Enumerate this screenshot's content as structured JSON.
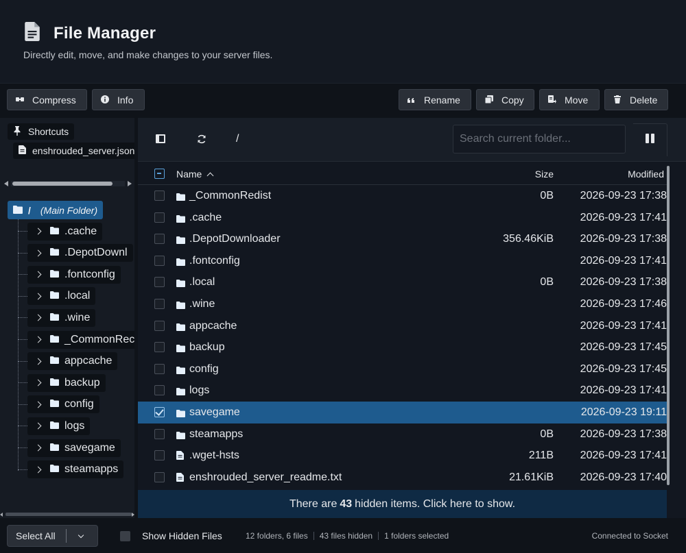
{
  "header": {
    "icon": "file-icon",
    "title": "File Manager",
    "subtitle": "Directly edit, move, and make changes to your server files."
  },
  "toolbar": {
    "compress": "Compress",
    "info": "Info",
    "rename": "Rename",
    "copy": "Copy",
    "move": "Move",
    "delete": "Delete"
  },
  "sidebar": {
    "shortcuts_label": "Shortcuts",
    "shortcut_file": "enshrouded_server.json",
    "root_slash": "/",
    "root_label": "(Main Folder)",
    "tree": [
      ".cache",
      ".DepotDownl",
      ".fontconfig",
      ".local",
      ".wine",
      "_CommonRec",
      "appcache",
      "backup",
      "config",
      "logs",
      "savegame",
      "steamapps"
    ]
  },
  "main": {
    "path": "/",
    "search_placeholder": "Search current folder...",
    "columns": {
      "name": "Name",
      "size": "Size",
      "modified": "Modified"
    },
    "rows": [
      {
        "type": "folder",
        "name": "_CommonRedist",
        "size": "0B",
        "modified": "2026-09-23 17:38",
        "selected": false
      },
      {
        "type": "folder",
        "name": ".cache",
        "size": "",
        "modified": "2026-09-23 17:41",
        "selected": false
      },
      {
        "type": "folder",
        "name": ".DepotDownloader",
        "size": "356.46KiB",
        "modified": "2026-09-23 17:38",
        "selected": false
      },
      {
        "type": "folder",
        "name": ".fontconfig",
        "size": "",
        "modified": "2026-09-23 17:41",
        "selected": false
      },
      {
        "type": "folder",
        "name": ".local",
        "size": "0B",
        "modified": "2026-09-23 17:38",
        "selected": false
      },
      {
        "type": "folder",
        "name": ".wine",
        "size": "",
        "modified": "2026-09-23 17:46",
        "selected": false
      },
      {
        "type": "folder",
        "name": "appcache",
        "size": "",
        "modified": "2026-09-23 17:41",
        "selected": false
      },
      {
        "type": "folder",
        "name": "backup",
        "size": "",
        "modified": "2026-09-23 17:45",
        "selected": false
      },
      {
        "type": "folder",
        "name": "config",
        "size": "",
        "modified": "2026-09-23 17:45",
        "selected": false
      },
      {
        "type": "folder",
        "name": "logs",
        "size": "",
        "modified": "2026-09-23 17:41",
        "selected": false
      },
      {
        "type": "folder",
        "name": "savegame",
        "size": "",
        "modified": "2026-09-23 19:11",
        "selected": true
      },
      {
        "type": "folder",
        "name": "steamapps",
        "size": "0B",
        "modified": "2026-09-23 17:38",
        "selected": false
      },
      {
        "type": "file",
        "name": ".wget-hsts",
        "size": "211B",
        "modified": "2026-09-23 17:41",
        "selected": false
      },
      {
        "type": "file",
        "name": "enshrouded_server_readme.txt",
        "size": "21.61KiB",
        "modified": "2026-09-23 17:40",
        "selected": false
      }
    ],
    "hidden_banner": {
      "prefix": "There are",
      "count": "43",
      "suffix": "hidden items. Click here to show."
    }
  },
  "footer": {
    "select_all": "Select All",
    "show_hidden": "Show Hidden Files",
    "counts": "12 folders, 6 files",
    "hidden": "43 files hidden",
    "selected": "1 folders selected",
    "status": "Connected to Socket"
  },
  "colors": {
    "accent": "#1e5b8e",
    "banner": "#0f2a44",
    "folder_icon": "#e6f0fb"
  }
}
